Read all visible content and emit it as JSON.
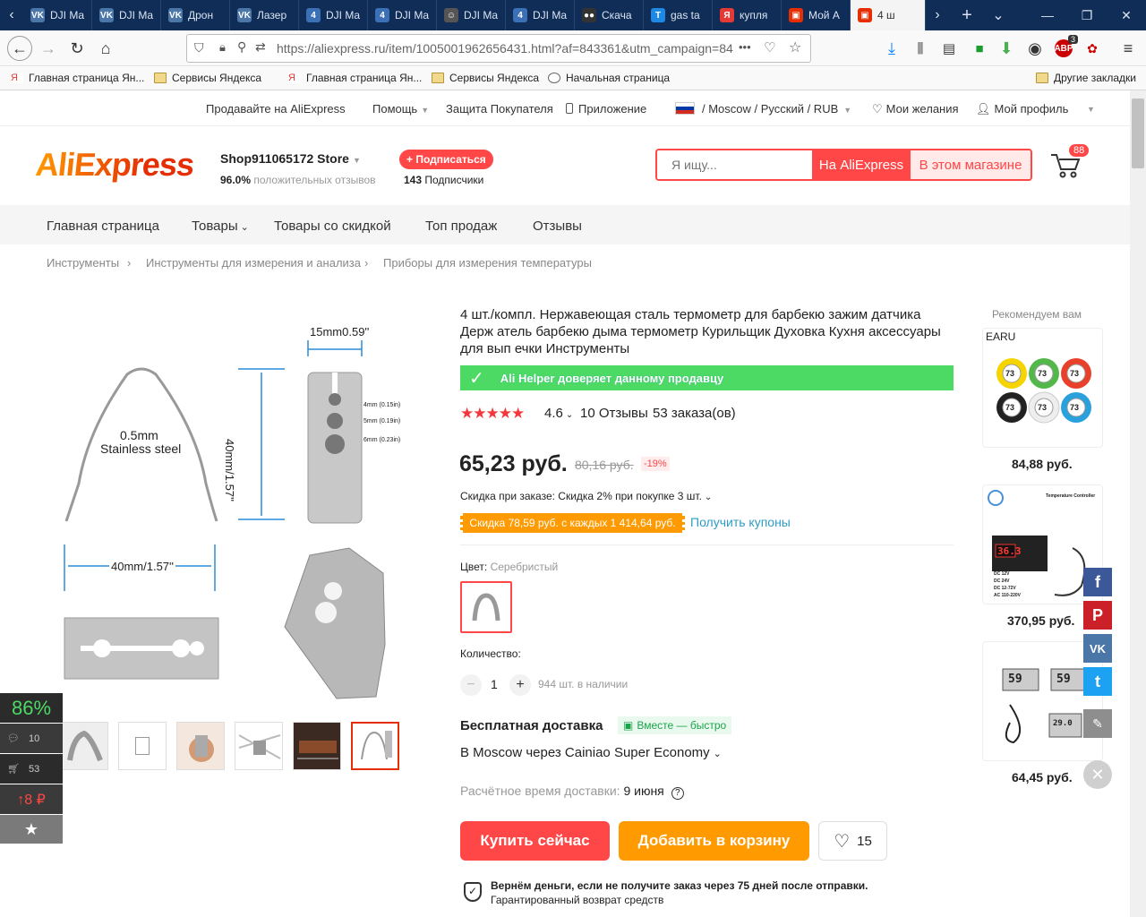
{
  "tabs": [
    {
      "label": "DJI Ma",
      "icon": "vk-icon",
      "color": "#4a76a8",
      "glyph": "VK"
    },
    {
      "label": "DJI Ma",
      "icon": "vk-icon",
      "color": "#4a76a8",
      "glyph": "VK"
    },
    {
      "label": "Дрон",
      "icon": "vk-icon",
      "color": "#4a76a8",
      "glyph": "VK"
    },
    {
      "label": "Лазер",
      "icon": "vk-icon",
      "color": "#4a76a8",
      "glyph": "VK"
    },
    {
      "label": "DJI Ma",
      "icon": "forum-icon",
      "color": "#3b6fb6",
      "glyph": "4"
    },
    {
      "label": "DJI Ma",
      "icon": "forum-icon",
      "color": "#3b6fb6",
      "glyph": "4"
    },
    {
      "label": "DJI Ma",
      "icon": "mask-icon",
      "color": "#555",
      "glyph": "☺"
    },
    {
      "label": "DJI Ma",
      "icon": "forum-icon",
      "color": "#3b6fb6",
      "glyph": "4"
    },
    {
      "label": "Скача",
      "icon": "eyes-icon",
      "color": "#333",
      "glyph": "●●"
    },
    {
      "label": "gas ta",
      "icon": "translate-icon",
      "color": "#1e88e5",
      "glyph": "T"
    },
    {
      "label": "купля",
      "icon": "yandex-icon",
      "color": "#e53935",
      "glyph": "Я"
    },
    {
      "label": "Мой А",
      "icon": "aliexpress-icon",
      "color": "#e62e04",
      "glyph": "▣"
    },
    {
      "label": "4 ш",
      "icon": "aliexpress-icon",
      "color": "#e62e04",
      "glyph": "▣"
    }
  ],
  "browser": {
    "url": "https://aliexpress.ru/item/1005001962656431.html?af=843361&utm_campaign=84",
    "url_more": "•••",
    "abp_badge": "3"
  },
  "bookmarks": [
    {
      "label": "Главная страница Ян...",
      "icon": "yandex-icon"
    },
    {
      "label": "Сервисы Яндекса",
      "icon": "folder-icon"
    },
    {
      "label": "Главная страница Ян...",
      "icon": "yandex-icon"
    },
    {
      "label": "Сервисы Яндекса",
      "icon": "folder-icon"
    },
    {
      "label": "Начальная страница",
      "icon": "globe-icon"
    }
  ],
  "bookmarks_other": "Другие закладки",
  "topnav": {
    "sell": "Продавайте на AliExpress",
    "help": "Помощь",
    "protection": "Защита Покупателя",
    "app": "Приложение",
    "region": "/ Moscow / Русский /  RUB",
    "wishlist": "Мои желания",
    "profile": "Мой профиль"
  },
  "store": {
    "logo": "AliExpress",
    "name": "Shop911065172 Store",
    "rating_value": "96.0%",
    "rating_text": "положительных отзывов",
    "subscribe_label": "+ Подписаться",
    "subscribers_count": "143",
    "subscribers_text": "Подписчики",
    "search_placeholder": "Я ищу...",
    "search_ali": "На AliExpress",
    "search_store": "В этом магазине",
    "cart_count": "88"
  },
  "catnav": [
    "Главная страница",
    "Товары",
    "Товары со скидкой",
    "Топ продаж",
    "Отзывы"
  ],
  "breadcrumbs": [
    "Инструменты",
    "Инструменты для измерения и анализа",
    "Приборы для измерения температуры"
  ],
  "image": {
    "dim_top": "15mm0.59''",
    "dim_side": "40mm/1.57''",
    "dim_bottom": "40mm/1.57''",
    "material_1": "0.5mm",
    "material_2": "Stainless steel",
    "hole_1": "4mm (0.15in)",
    "hole_2": "5mm (0.19in)",
    "hole_3": "6mm (0.23in)"
  },
  "product": {
    "title": "4 шт./компл. Нержавеющая сталь термометр для барбекю зажим датчика Держ атель барбекю дыма термометр Курильщик Духовка Кухня аксессуары для вып ечки Инструменты",
    "helper": "Ali Helper доверяет данному продавцу",
    "rating": "4.6",
    "stars": 4.6,
    "reviews": "10 Отзывы",
    "orders": "53 заказа(ов)",
    "price": "65,23 руб.",
    "old_price": "80,16 руб.",
    "discount": "-19%",
    "order_discount": "Скидка при заказе: Скидка 2% при покупке 3 шт.",
    "coupon": "Скидка 78,59 руб. с каждых 1 414,64 руб.",
    "get_coupons": "Получить купоны",
    "color_label": "Цвет:",
    "color_value": "Серебристый",
    "qty_label": "Количество:",
    "qty": "1",
    "stock": "944 шт. в наличии",
    "shipping_title": "Бесплатная доставка",
    "shipping_badge": "Вместе — быстро",
    "shipping_route": "В Moscow через Cainiao Super Economy",
    "eta_label": "Расчётное время доставки:",
    "eta_value": "9 июня",
    "buy_now": "Купить сейчас",
    "add_to_cart": "Добавить в корзину",
    "wish_count": "15",
    "guarantee": "Вернём деньги, если не получите заказ через 75 дней после отправки.",
    "guarantee_sub": "Гарантированный возврат средств"
  },
  "recommend": {
    "title": "Рекомендуем вам",
    "items": [
      {
        "brand": "EARU",
        "price": "84,88 руб."
      },
      {
        "brand": "",
        "price": "370,95 руб.",
        "caption": "Temperature Controller",
        "reading": "36.3"
      },
      {
        "brand": "",
        "price": "64,45 руб.",
        "reading": "59"
      }
    ]
  },
  "hygrometers": [
    "73",
    "73",
    "73",
    "73",
    "73",
    "73"
  ],
  "controller_specs": [
    "DC 12V",
    "DC 24V",
    "DC 12-72V",
    "AC 110-220V"
  ],
  "thumb_gauge": "29.0",
  "sidepanel": {
    "percent": "86%",
    "comments": "10",
    "cart": "53",
    "price_change": "↑8 ₽"
  },
  "colors": {
    "accent": "#ff4747",
    "orange": "#ff9a00",
    "green": "#4cd964",
    "aliorange": "#e62e04"
  }
}
